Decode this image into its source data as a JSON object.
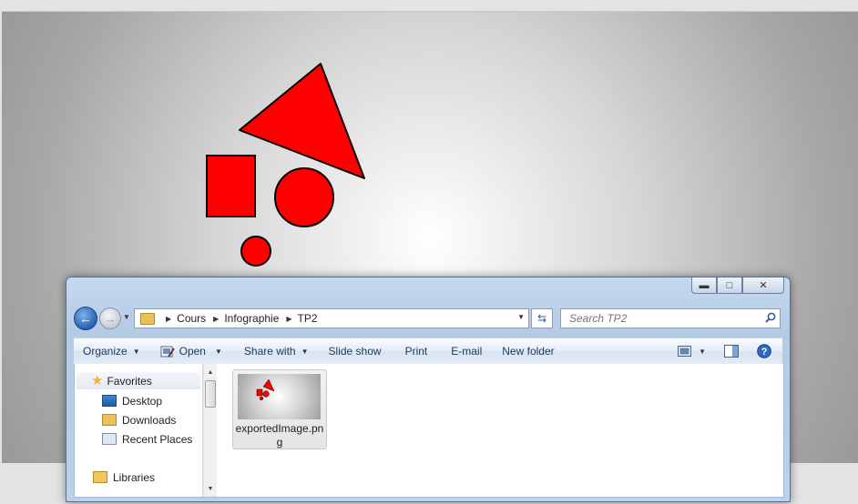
{
  "canvas": {
    "shapes": [
      {
        "kind": "triangle",
        "fill": "#ff0000",
        "stroke": "#000000"
      },
      {
        "kind": "rectangle",
        "fill": "#ff0000",
        "stroke": "#000000"
      },
      {
        "kind": "circle-large",
        "fill": "#ff0000",
        "stroke": "#000000"
      },
      {
        "kind": "circle-small",
        "fill": "#ff0000",
        "stroke": "#000000"
      }
    ]
  },
  "explorer": {
    "caption_buttons": {
      "minimize_icon": "minimize-icon",
      "maximize_icon": "maximize-icon",
      "close_icon": "close-icon"
    },
    "breadcrumb": [
      "Cours",
      "Infographie",
      "TP2"
    ],
    "search": {
      "placeholder": "Search TP2"
    },
    "toolbar": {
      "organize": "Organize",
      "open": "Open",
      "share_with": "Share with",
      "slide_show": "Slide show",
      "print": "Print",
      "email": "E-mail",
      "new_folder": "New folder"
    },
    "nav_pane": {
      "favorites": "Favorites",
      "desktop": "Desktop",
      "downloads": "Downloads",
      "recent_places": "Recent Places",
      "libraries": "Libraries"
    },
    "files": [
      {
        "name": "exportedImage.png"
      }
    ],
    "colors": {
      "accent": "#2a62b4",
      "shape_fill": "#ff0000"
    }
  }
}
